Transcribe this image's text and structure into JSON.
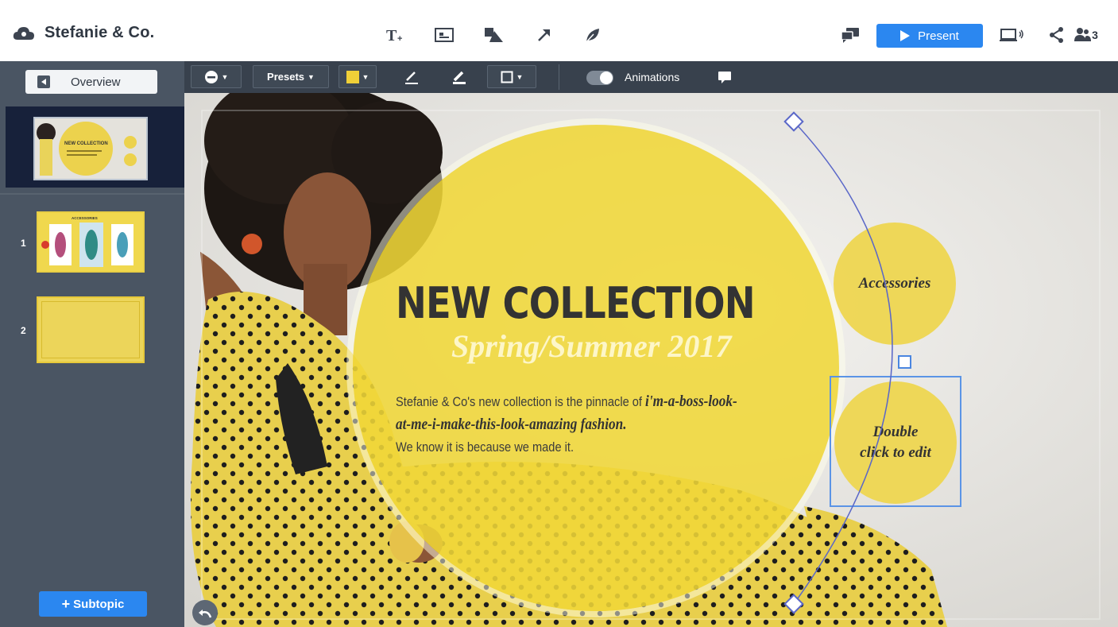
{
  "app": {
    "title": "Stefanie & Co.",
    "present_label": "Present",
    "collaborator_count": "3",
    "accent_color": "#2b87f0"
  },
  "top_tools": [
    {
      "name": "text-tool",
      "icon": "text-plus-icon"
    },
    {
      "name": "image-tool",
      "icon": "image-icon"
    },
    {
      "name": "shape-tool",
      "icon": "shapes-icon"
    },
    {
      "name": "arrow-tool",
      "icon": "arrow-icon"
    },
    {
      "name": "draw-tool",
      "icon": "leaf-icon"
    }
  ],
  "top_right_icons": [
    "comments-icon",
    "screen-audio-icon",
    "share-icon",
    "users-icon"
  ],
  "sidebar": {
    "overview_label": "Overview",
    "slides": [
      {
        "number": "1",
        "thumb_title": "ACCESSORIES"
      },
      {
        "number": "2"
      }
    ],
    "subtopic_label": "Subtopic"
  },
  "format_toolbar": {
    "presets_label": "Presets",
    "fill_color": "#f0d038",
    "animations_label": "Animations",
    "animations_on": true
  },
  "slide": {
    "headline": "NEW COLLECTION",
    "subhead": "Spring/Summer 2017",
    "body_prefix": "Stefanie & Co's new collection is the pinnacle of ",
    "body_emphasis": "i'm-a-boss-look-at-me-i-make-this-look-amazing fashion.",
    "body_suffix": "We know it is because we made it.",
    "circle_accessories": "Accessories",
    "circle_edit_line1": "Double",
    "circle_edit_line2": "click to edit",
    "thumb_title": "NEW COLLECTION"
  }
}
